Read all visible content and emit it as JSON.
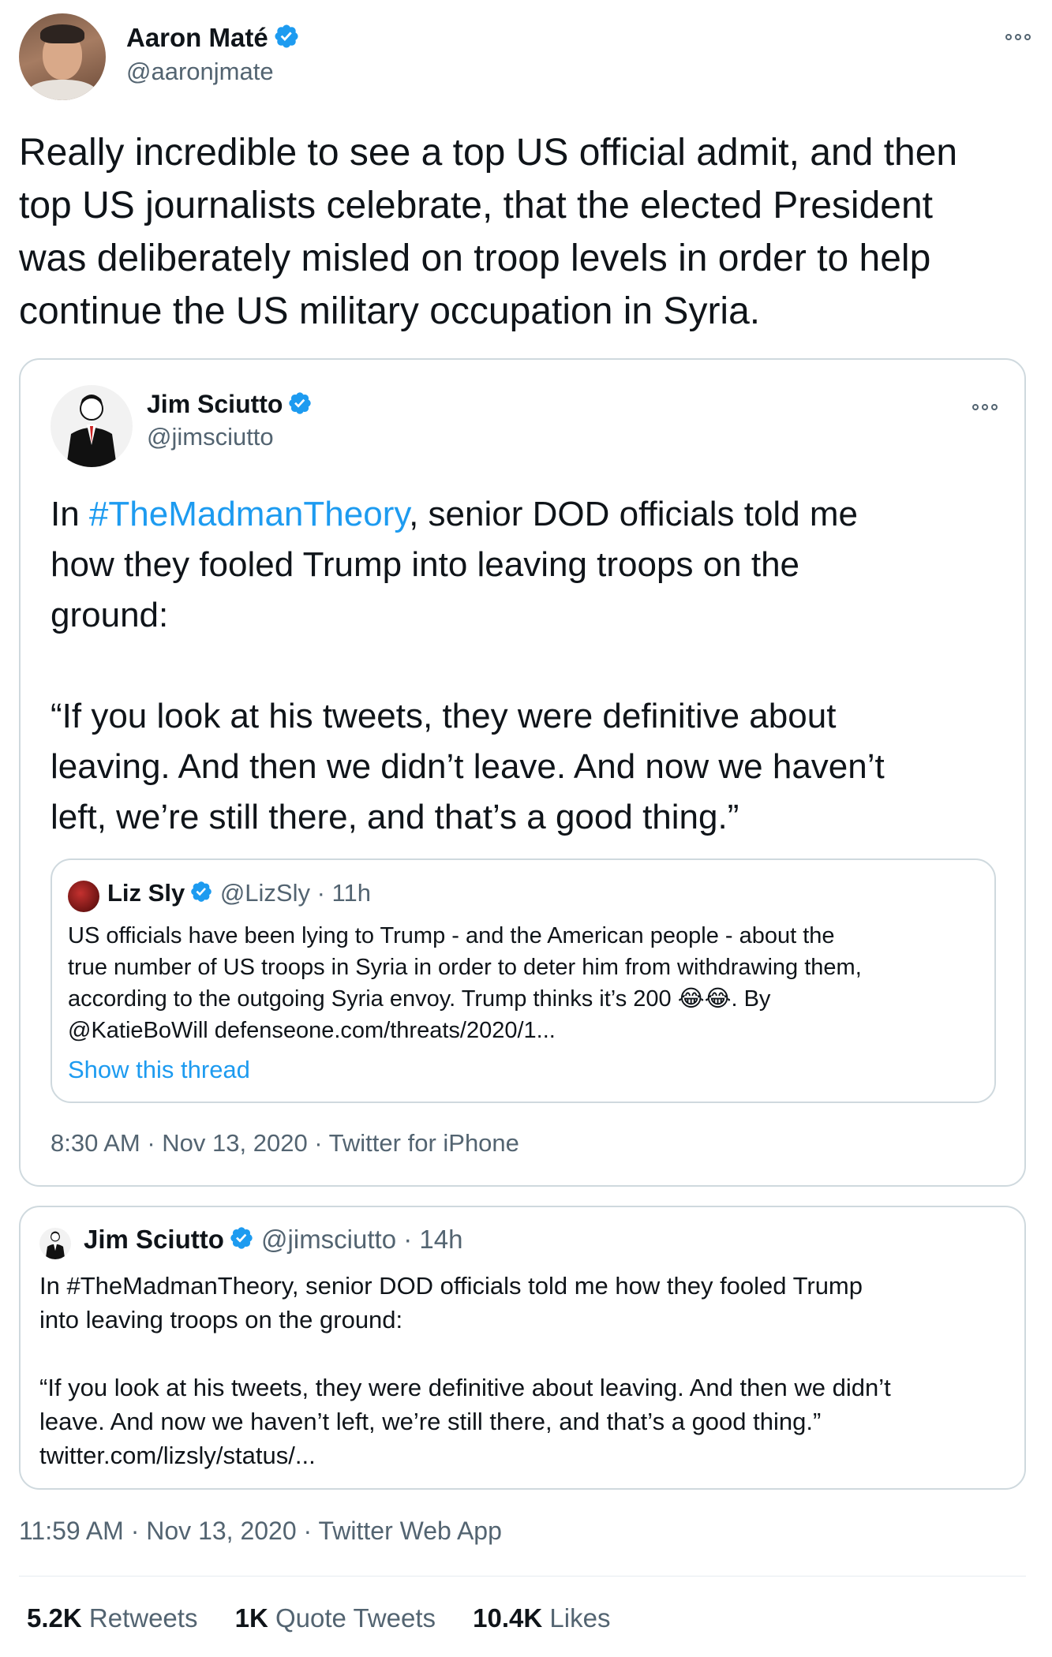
{
  "colors": {
    "accent": "#1d9bf0",
    "muted": "#536471",
    "text": "#0f1419",
    "border": "#cfd9de"
  },
  "main_tweet": {
    "author_name": "Aaron Maté",
    "author_handle": "@aaronjmate",
    "verified_icon": "verified-badge-icon",
    "more_icon": "more-options-icon",
    "text": "Really incredible to see a top US official admit, and then\ntop US journalists celebrate, that the elected President\nwas deliberately misled on troop levels in order to help\ncontinue the US military occupation in Syria.",
    "timestamp": "11:59 AM · Nov 13, 2020 · Twitter Web App",
    "stats": {
      "retweets_count": "5.2K",
      "retweets_label": "Retweets",
      "quotes_count": "1K",
      "quotes_label": "Quote Tweets",
      "likes_count": "10.4K",
      "likes_label": "Likes"
    }
  },
  "quoted_tweet": {
    "author_name": "Jim Sciutto",
    "author_handle": "@jimsciutto",
    "text_prefix": "In ",
    "hashtag": "#TheMadmanTheory",
    "text_line1_suffix": ", senior DOD officials told me",
    "text_line2": "how they fooled Trump into leaving troops on the",
    "text_line3": "ground:",
    "quote_line1": "“If you look at his tweets, they were definitive about",
    "quote_line2": "leaving. And then we didn’t leave. And now we haven’t",
    "quote_line3": "left, we’re still there, and that’s a good thing.”",
    "timestamp": "8:30 AM · Nov 13, 2020 · Twitter for iPhone",
    "nested_quote": {
      "author_name": "Liz Sly",
      "author_handle": "@LizSly · 11h",
      "line1": "US officials have been lying to Trump - and the American people - about the",
      "line2": "true number of US troops in Syria in order to deter him from withdrawing them,",
      "line3": "according to the outgoing Syria envoy. Trump thinks it’s 200 😂😂. By",
      "line4": "@KatieBoWill defenseone.com/threats/2020/1...",
      "show_thread": "Show this thread"
    }
  },
  "second_quoted_tweet": {
    "author_name": "Jim Sciutto",
    "author_handle": "@jimsciutto · 14h",
    "line1": "In #TheMadmanTheory, senior DOD officials told me how they fooled Trump",
    "line2": "into leaving troops on the ground:",
    "line3": "“If you look at his tweets, they were definitive about leaving. And then we didn’t",
    "line4": "leave. And now we haven’t left, we’re still there, and that’s a good thing.”",
    "line5": "twitter.com/lizsly/status/..."
  }
}
